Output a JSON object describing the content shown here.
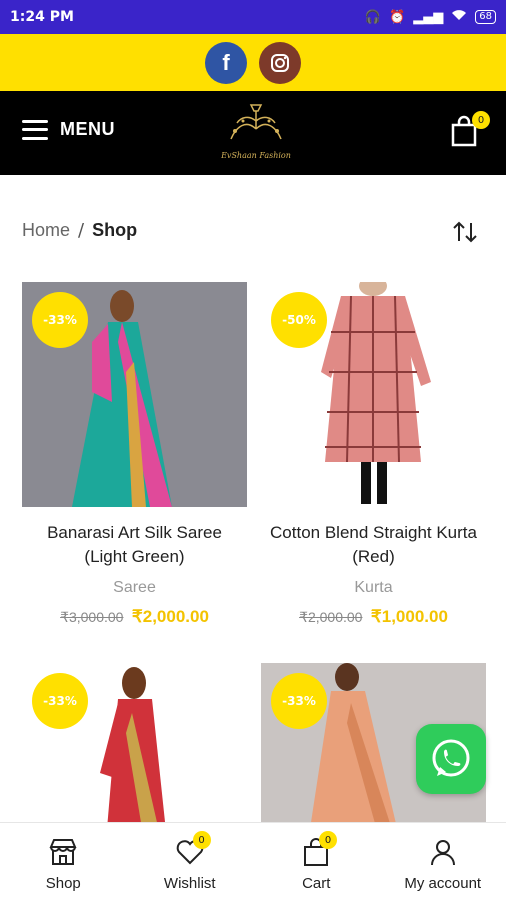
{
  "status_bar": {
    "time": "1:24 PM",
    "battery": "68"
  },
  "header": {
    "menu_label": "MENU",
    "cart_count": "0",
    "logo_text": "EvShaan Fashion"
  },
  "breadcrumb": {
    "home": "Home",
    "separator": "/",
    "current": "Shop"
  },
  "products": [
    {
      "name": "Banarasi Art Silk Saree (Light Green)",
      "category": "Saree",
      "old_price": "₹3,000.00",
      "new_price": "₹2,000.00",
      "discount": "-33%"
    },
    {
      "name": "Cotton Blend Straight Kurta (Red)",
      "category": "Kurta",
      "old_price": "₹2,000.00",
      "new_price": "₹1,000.00",
      "discount": "-50%"
    },
    {
      "name": "",
      "category": "",
      "old_price": "",
      "new_price": "",
      "discount": "-33%"
    },
    {
      "name": "",
      "category": "",
      "old_price": "",
      "new_price": "",
      "discount": "-33%"
    }
  ],
  "bottom_nav": [
    {
      "label": "Shop",
      "icon": "store-icon"
    },
    {
      "label": "Wishlist",
      "icon": "heart-icon",
      "badge": "0"
    },
    {
      "label": "Cart",
      "icon": "shopping-bag-icon",
      "badge": "0"
    },
    {
      "label": "My account",
      "icon": "user-icon"
    }
  ],
  "colors": {
    "accent": "#ffe000",
    "status_bar": "#3a24c9",
    "header": "#000000",
    "price": "#f3c300"
  }
}
